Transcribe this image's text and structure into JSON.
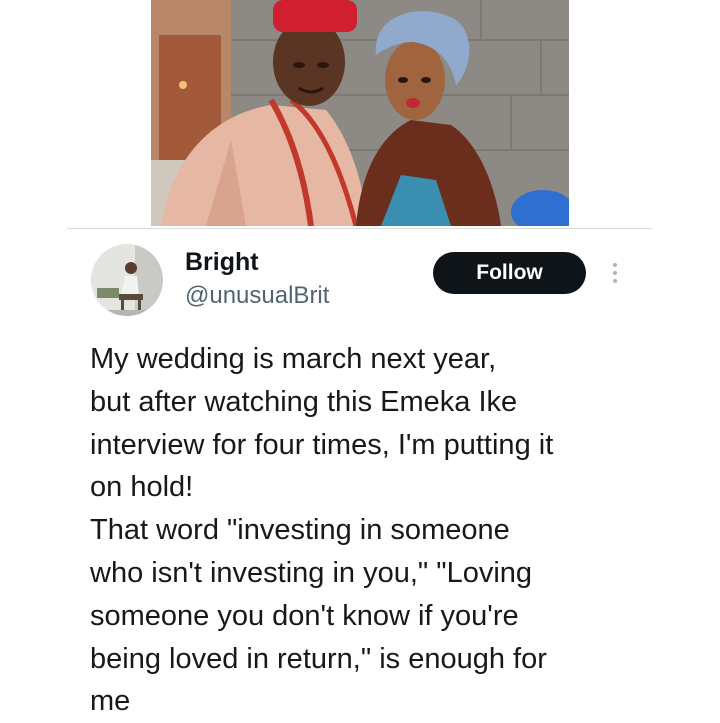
{
  "tweet": {
    "author": {
      "display_name": "Bright",
      "handle": "@unusualBrit"
    },
    "follow_label": "Follow",
    "more_icon": "more-vertical-icon",
    "text_lines": [
      "My wedding is march next year,",
      "but after watching this Emeka Ike",
      "interview for four times, I'm putting it",
      "on hold!",
      "That word \"investing in someone",
      "who isn't investing in you,\" \"Loving",
      "someone you don't know if you're",
      "being loved in return,\" is enough for",
      "me"
    ]
  },
  "colors": {
    "follow_button_bg": "#0f1419",
    "handle_text": "#536471",
    "body_text": "#16191c"
  }
}
